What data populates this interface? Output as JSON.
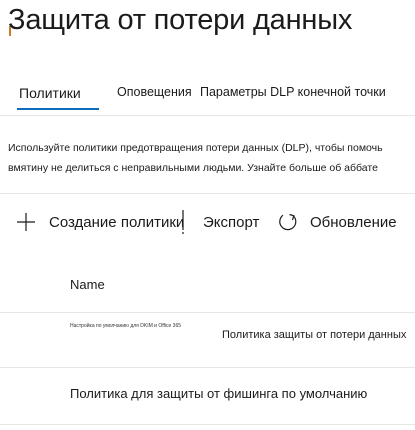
{
  "page": {
    "title": "Защита от потери данных"
  },
  "tabs": [
    {
      "label": "Политики",
      "active": true
    },
    {
      "label": "Оповещения",
      "active": false
    },
    {
      "label": "Параметры DLP конечной точки",
      "active": false
    }
  ],
  "description": "Используйте политики предотвращения потери данных (DLP), чтобы помочь вмятину не делиться с неправильными людьми. Узнайте больше об аббате",
  "toolbar": {
    "create_label": "Создание политики",
    "export_label": "Экспорт",
    "refresh_label": "Обновление"
  },
  "table": {
    "column_header": "Name",
    "rows": [
      {
        "small_text": "Настройка по умолчанию для DKIM и Office 365",
        "name": "Политика защиты от потери данных"
      },
      {
        "name": "Политика для защиты от фишинга по умолчанию"
      }
    ]
  },
  "colors": {
    "accent": "#0f6cbd",
    "text": "#1b1b1b",
    "divider": "#e6e6e6"
  }
}
